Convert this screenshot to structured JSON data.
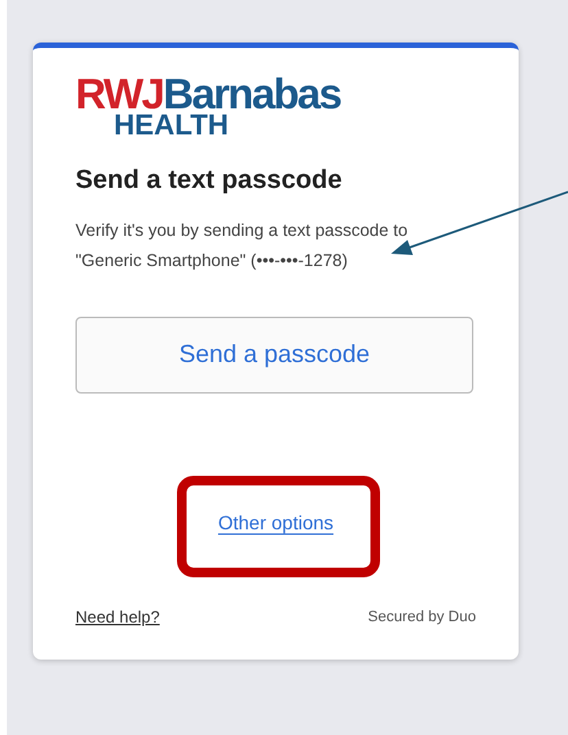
{
  "logo": {
    "part_1": "RWJ",
    "part_2": "Barnabas",
    "part_3": "HEALTH"
  },
  "title": "Send a text passcode",
  "description": "Verify it's you by sending a text passcode to \"Generic Smartphone\" (•••-•••-1278)",
  "primary_button": "Send a passcode",
  "other_options_link": "Other options",
  "footer": {
    "help_link": "Need help?",
    "secured_by": "Secured by Duo"
  }
}
